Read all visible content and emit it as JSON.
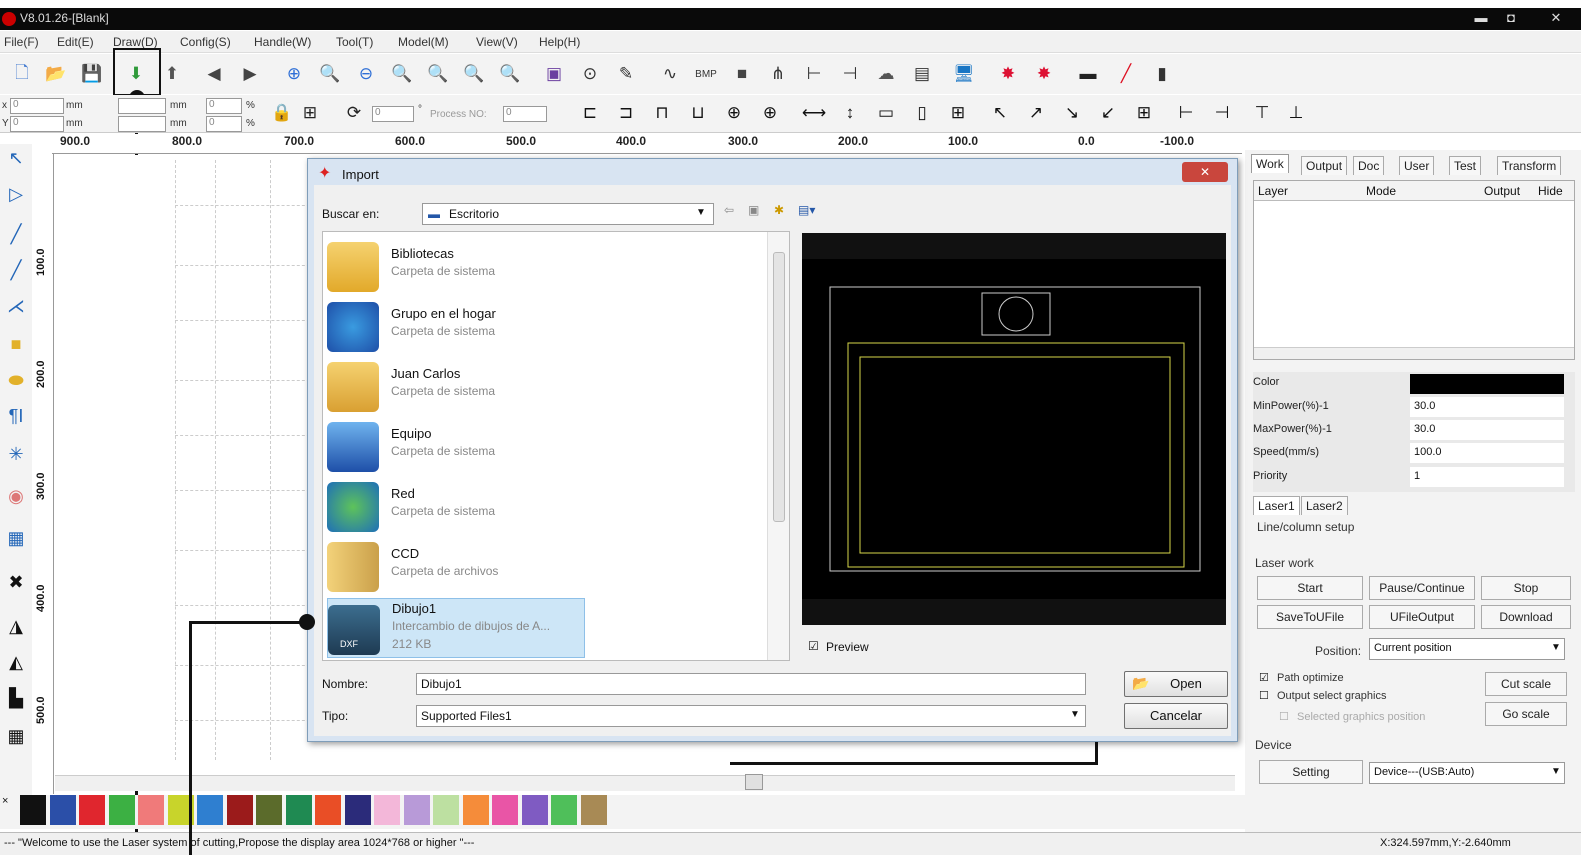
{
  "app": {
    "title": "V8.01.26-[Blank]"
  },
  "menu": [
    "File(F)",
    "Edit(E)",
    "Draw(D)",
    "Config(S)",
    "Handle(W)",
    "Tool(T)",
    "Model(M)",
    "View(V)",
    "Help(H)"
  ],
  "toolbar2": {
    "x_label": "x",
    "y_label": "Y",
    "x_val": "0",
    "y_val": "0",
    "unit_mm": "mm",
    "percent": "%",
    "rot_val": "0",
    "deg": "°",
    "process_label": "Process NO:",
    "process_val": "0"
  },
  "ruler_top": [
    "900.0",
    "800.0",
    "700.0",
    "600.0",
    "500.0",
    "400.0",
    "300.0",
    "200.0",
    "100.0",
    "0.0",
    "-100.0"
  ],
  "ruler_left": [
    "100.0",
    "200.0",
    "300.0",
    "400.0",
    "500.0"
  ],
  "palette": {
    "x_mark": "×",
    "colors": [
      "#111111",
      "#2b4fa8",
      "#e0262e",
      "#3cb043",
      "#f07a7a",
      "#c8d42b",
      "#2f7fd0",
      "#9b1b1b",
      "#5b6b2b",
      "#1f8a52",
      "#e94e26",
      "#2b2b7a",
      "#f3b7d9",
      "#b89ad8",
      "#bde0a1",
      "#f58c3a",
      "#e955a6",
      "#7f5bc2",
      "#4fbf5a",
      "#a88a55"
    ]
  },
  "status": {
    "message": "--- \"Welcome to use the Laser system of cutting,Propose the display area 1024*768 or higher \"---",
    "coords": "X:324.597mm,Y:-2.640mm"
  },
  "right_panel": {
    "tabs": [
      "Work",
      "Output",
      "Doc",
      "User",
      "Test",
      "Transform"
    ],
    "columns": [
      "Layer",
      "Mode",
      "Output",
      "Hide"
    ],
    "props": [
      {
        "label": "Color",
        "value": ""
      },
      {
        "label": "MinPower(%)-1",
        "value": "30.0"
      },
      {
        "label": "MaxPower(%)-1",
        "value": "30.0"
      },
      {
        "label": "Speed(mm/s)",
        "value": "100.0"
      },
      {
        "label": "Priority",
        "value": "1"
      }
    ],
    "laser_tabs": [
      "Laser1",
      "Laser2"
    ],
    "line_column": "Line/column setup",
    "laser_work": "Laser work",
    "btn_start": "Start",
    "btn_pause": "Pause/Continue",
    "btn_stop": "Stop",
    "btn_save": "SaveToUFile",
    "btn_ufile": "UFileOutput",
    "btn_download": "Download",
    "position_label": "Position:",
    "position_value": "Current position",
    "chk_path": "Path optimize",
    "chk_output_select": "Output select graphics",
    "chk_selected_pos": "Selected graphics position",
    "btn_cut_scale": "Cut scale",
    "btn_go_scale": "Go scale",
    "device_label": "Device",
    "btn_setting": "Setting",
    "device_value": "Device---(USB:Auto)",
    "color_swatch": "#000000"
  },
  "dialog": {
    "title": "Import",
    "lookin_label": "Buscar en:",
    "lookin_value": "Escritorio",
    "files": [
      {
        "name": "Bibliotecas",
        "desc": "Carpeta de sistema",
        "size": ""
      },
      {
        "name": "Grupo en el hogar",
        "desc": "Carpeta de sistema",
        "size": ""
      },
      {
        "name": "Juan Carlos",
        "desc": "Carpeta de sistema",
        "size": ""
      },
      {
        "name": "Equipo",
        "desc": "Carpeta de sistema",
        "size": ""
      },
      {
        "name": "Red",
        "desc": "Carpeta de sistema",
        "size": ""
      },
      {
        "name": "CCD",
        "desc": "Carpeta de archivos",
        "size": ""
      },
      {
        "name": "Dibujo1",
        "desc": "Intercambio de dibujos de A...",
        "size": "212 KB"
      }
    ],
    "dxf_badge": "DXF",
    "preview_label": "Preview",
    "name_label": "Nombre:",
    "name_value": "Dibujo1",
    "type_label": "Tipo:",
    "type_value": "Supported Files1",
    "open_label": "Open",
    "cancel_label": "Cancelar",
    "close": "✕"
  }
}
